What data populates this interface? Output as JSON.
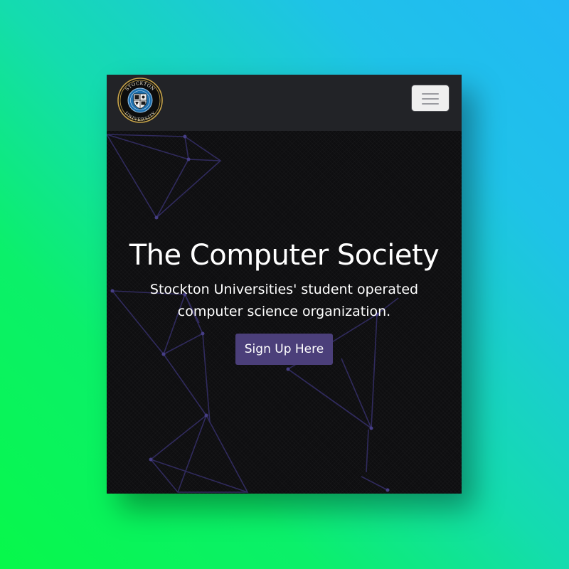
{
  "navbar": {
    "logo": {
      "top_text": "STOCKTON",
      "bottom_text": "UNIVERSITY",
      "icon": "university-seal-icon"
    },
    "toggler_icon": "hamburger-menu-icon"
  },
  "hero": {
    "title": "The Computer Society",
    "subtitle": "Stockton Universities' student operated computer science organization.",
    "cta_label": "Sign Up Here"
  },
  "colors": {
    "navbar_bg": "#222327",
    "hero_bg": "#0e0e10",
    "cta_bg": "#4b3f7a",
    "network_line": "#3a3470",
    "page_gradient_start": "#22b8f5",
    "page_gradient_end": "#07f84a"
  }
}
